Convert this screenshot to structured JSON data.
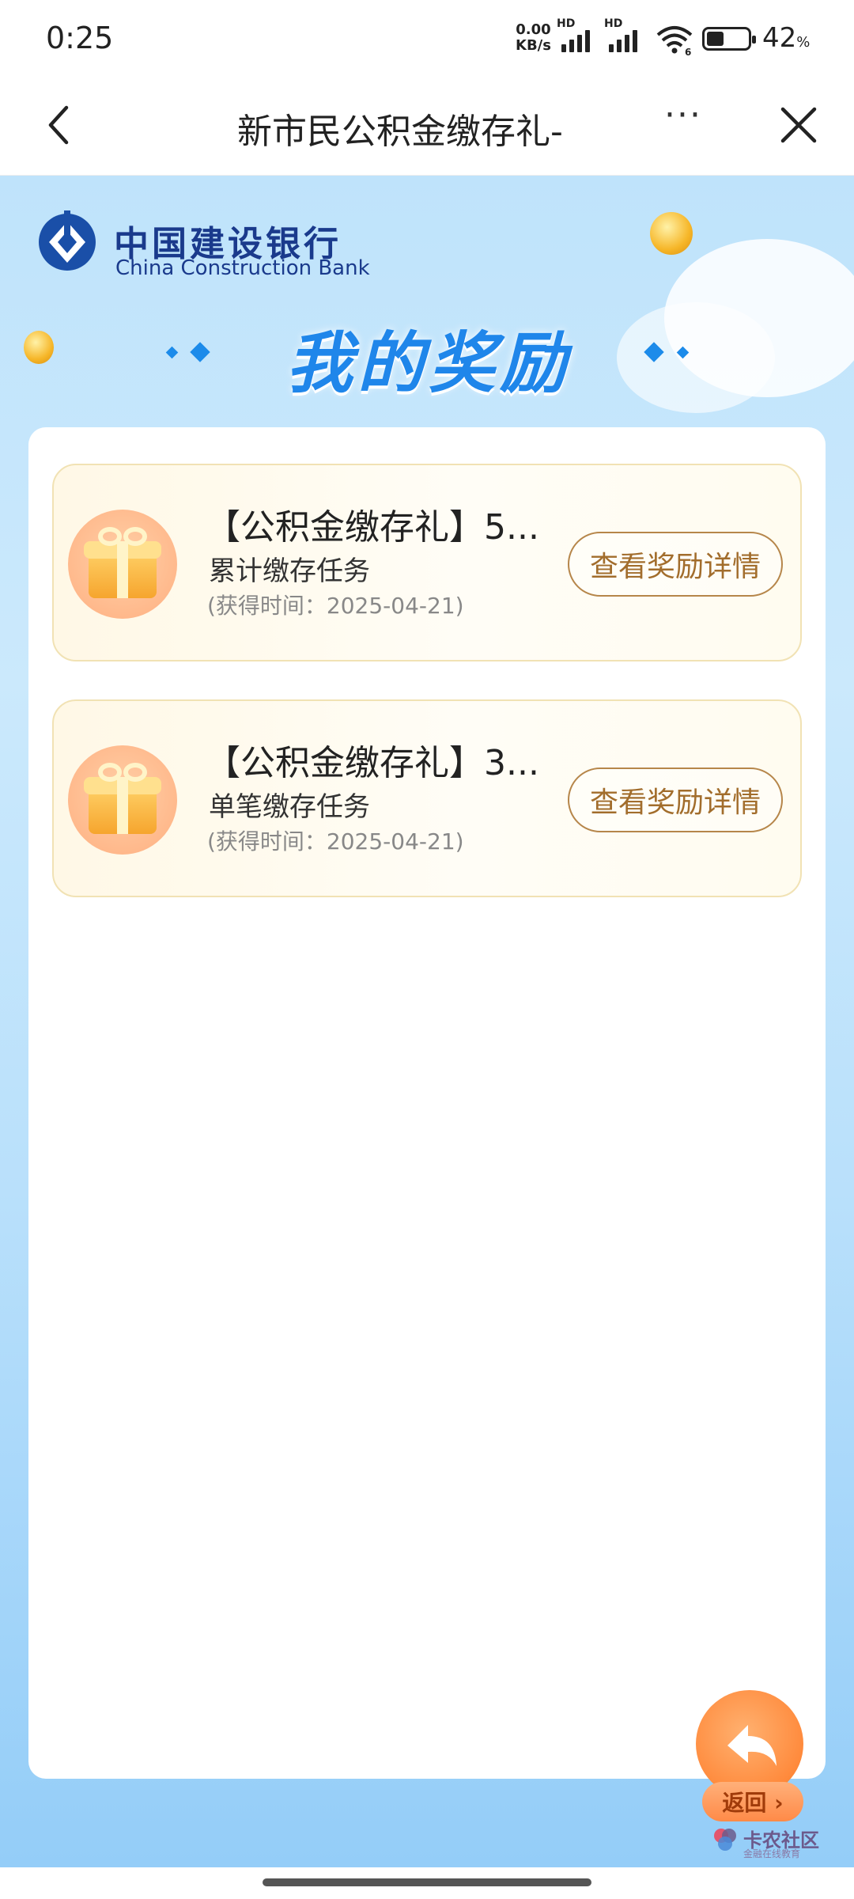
{
  "status": {
    "time": "0:25",
    "net_speed_value": "0.00",
    "net_speed_unit": "KB/s",
    "sig1_label": "HD",
    "sig2_label": "HD",
    "wifi_badge": "6",
    "battery_percent": "42",
    "battery_unit": "%",
    "battery_level": 0.42
  },
  "nav": {
    "title": "新市民公积金缴存礼-",
    "more_label": "···",
    "back_icon": "chevron-left-icon",
    "close_icon": "close-icon"
  },
  "brand": {
    "name_cn": "中国建设银行",
    "name_en": "China Construction Bank"
  },
  "hero": {
    "title": "我的奖励"
  },
  "rewards": [
    {
      "title": "【公积金缴存礼】5...",
      "task": "累计缴存任务",
      "time": "(获得时间：2025-04-21)",
      "button": "查看奖励详情"
    },
    {
      "title": "【公积金缴存礼】3...",
      "task": "单笔缴存任务",
      "time": "(获得时间：2025-04-21)",
      "button": "查看奖励详情"
    }
  ],
  "return": {
    "label": "返回 ›"
  },
  "watermark": {
    "main": "卡农社区",
    "sub": "金融在线教育"
  },
  "colors": {
    "accent": "#1f86ea",
    "gold_button": "#a26d2c",
    "return_orange": "#ff8a3c"
  }
}
